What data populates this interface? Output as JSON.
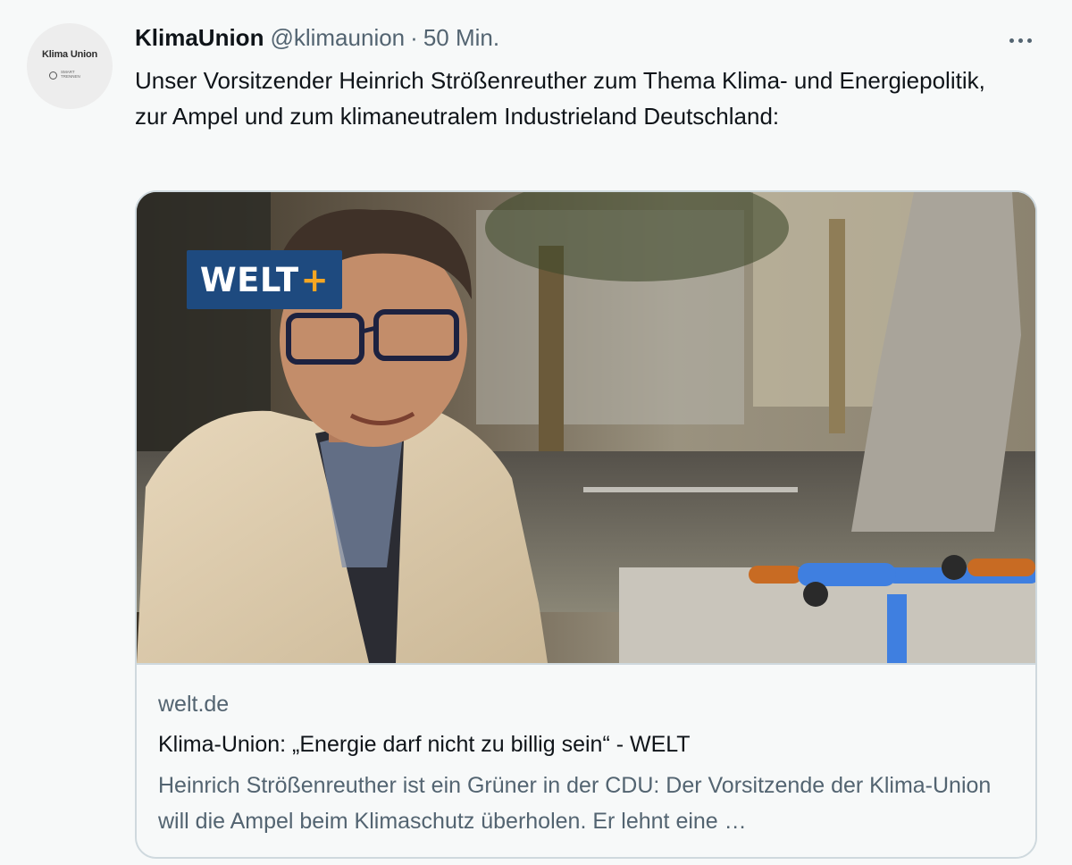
{
  "author": {
    "avatar_text": "Klima Union",
    "avatar_subtext": "SMART TRENNEN",
    "name": "KlimaUnion",
    "handle": "@klimaunion",
    "separator": "·",
    "time": "50 Min."
  },
  "tweet": {
    "text": "Unser Vorsitzender Heinrich Strößenreuther zum Thema Klima- und Energiepolitik, zur Ampel und zum klimaneutralem Industrieland Deutschland:"
  },
  "card": {
    "badge_text": "WELT",
    "badge_plus": "+",
    "domain": "welt.de",
    "title": "Klima-Union: „Energie darf nicht zu billig sein“ - WELT",
    "description": "Heinrich Strößenreuther ist ein Grüner in der CDU: Der Vorsitzende der Klima-Union will die Ampel beim Klimaschutz überholen. Er lehnt eine …"
  },
  "icons": {
    "more": "more-horizontal-icon"
  },
  "colors": {
    "text_primary": "#0f1419",
    "text_secondary": "#536471",
    "card_border": "#cfd9de",
    "badge_bg": "#1e4a7f",
    "badge_plus": "#f5a623"
  }
}
